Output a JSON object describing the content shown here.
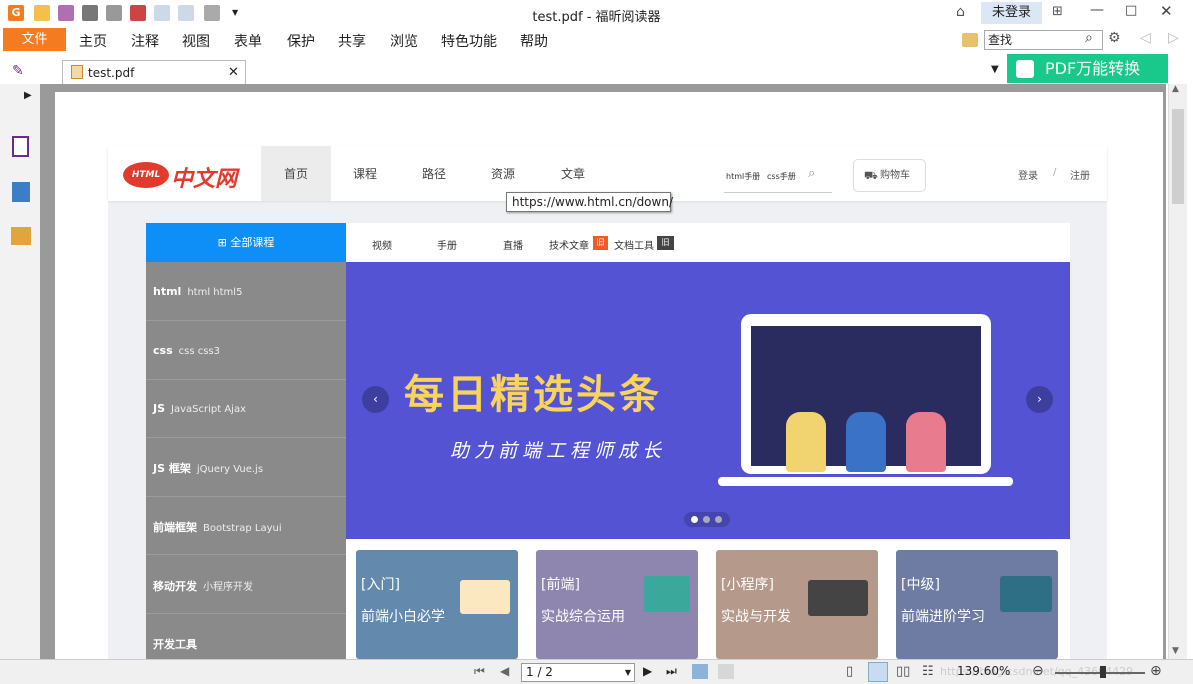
{
  "window": {
    "title": "test.pdf - 福昕阅读器",
    "login": "未登录"
  },
  "menu": {
    "file": "文件",
    "items": [
      "主页",
      "注释",
      "视图",
      "表单",
      "保护",
      "共享",
      "浏览",
      "特色功能",
      "帮助"
    ]
  },
  "search": {
    "value": "查找"
  },
  "tab": {
    "label": "test.pdf"
  },
  "promo": {
    "label": "PDF万能转换"
  },
  "site": {
    "logo": "中文网",
    "logo_badge": "HTML",
    "nav": [
      "首页",
      "课程",
      "路径",
      "资源",
      "文章"
    ],
    "search_hints": [
      "html手册",
      "css手册"
    ],
    "cart": "购物车",
    "login": "登录",
    "sep": "/",
    "register": "注册",
    "all_courses": "全部课程",
    "courses": [
      {
        "main": "html",
        "sub": "html  html5"
      },
      {
        "main": "css",
        "sub": "css  css3"
      },
      {
        "main": "JS",
        "sub": "JavaScript  Ajax"
      },
      {
        "main": "JS 框架",
        "sub": "jQuery  Vue.js"
      },
      {
        "main": "前端框架",
        "sub": "Bootstrap  Layui"
      },
      {
        "main": "移动开发",
        "sub": "小程序开发"
      },
      {
        "main": "开发工具",
        "sub": ""
      }
    ],
    "subnav": [
      "视频",
      "手册",
      "直播",
      "技术文章",
      "文档工具"
    ],
    "subnav_badges": [
      "旧",
      "旧"
    ],
    "banner_title": "每日精选头条",
    "banner_sub": "助力前端工程师成长",
    "cards": [
      {
        "tag": "[入门]",
        "label": "前端小白必学",
        "color": "#6389ad"
      },
      {
        "tag": "[前端]",
        "label": "实战综合运用",
        "color": "#8f86b0"
      },
      {
        "tag": "[小程序]",
        "label": "实战与开发",
        "color": "#b59a8c"
      },
      {
        "tag": "[中级]",
        "label": "前端进阶学习",
        "color": "#6e7ba3"
      }
    ]
  },
  "tooltip": "https://www.html.cn/down/",
  "status": {
    "page": "1 / 2",
    "zoom": "139.60%",
    "watermark": "https://blog.csdn.net/qq_43604429"
  }
}
